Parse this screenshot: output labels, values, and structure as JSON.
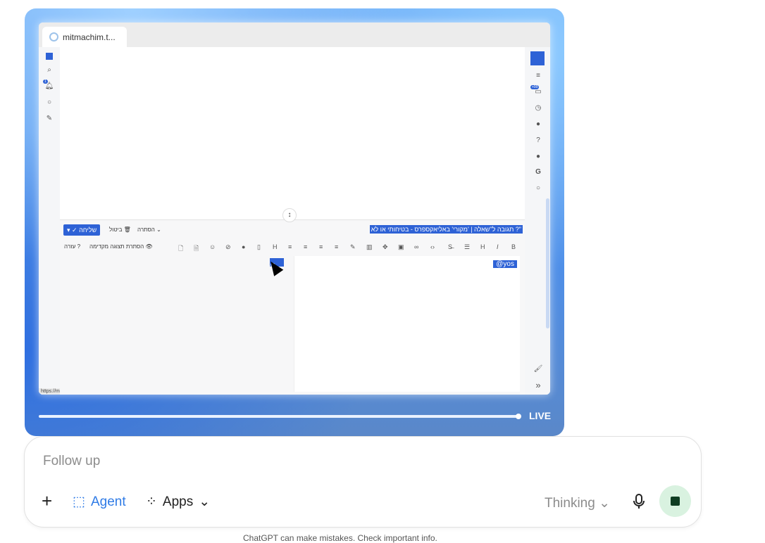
{
  "browser": {
    "tab_title": "mitmachim.t...",
    "status_url": "https://mitmachim.top/user/yos"
  },
  "left_sidebar": {
    "icons": [
      "square-icon",
      "search-icon",
      "bell-icon",
      "chat-icon",
      "edit-icon"
    ],
    "notification_count": "1"
  },
  "right_sidebar": {
    "icons": [
      "menu-icon",
      "inbox-icon",
      "clock-icon",
      "fire-icon",
      "help-icon",
      "user-icon",
      "google-icon",
      "chat-icon",
      "brush-icon",
      "expand-icon"
    ],
    "badge": "+99"
  },
  "composer": {
    "title": "תגובה ל\"שאלה | 'מקורי' באליאקספרס - בטיחותי או לא ?\"",
    "send_label": "שליחה",
    "discard_label": "ביטול",
    "hide_label": "הסתרה",
    "help_label": "עזרה",
    "hide_preview_label": "הסתרת תצוגה מקדימה",
    "mention_text": "@yos",
    "preview_text": "@"
  },
  "player": {
    "live_label": "LIVE",
    "progress": 1.0
  },
  "chat_input": {
    "placeholder": "Follow up",
    "agent_label": "Agent",
    "apps_label": "Apps",
    "thinking_label": "Thinking"
  },
  "footer": {
    "text": "ChatGPT can make mistakes. Check important info."
  },
  "colors": {
    "accent": "#2e62d6",
    "agent": "#2f7be6",
    "stop_bg": "#d9f2e0"
  }
}
